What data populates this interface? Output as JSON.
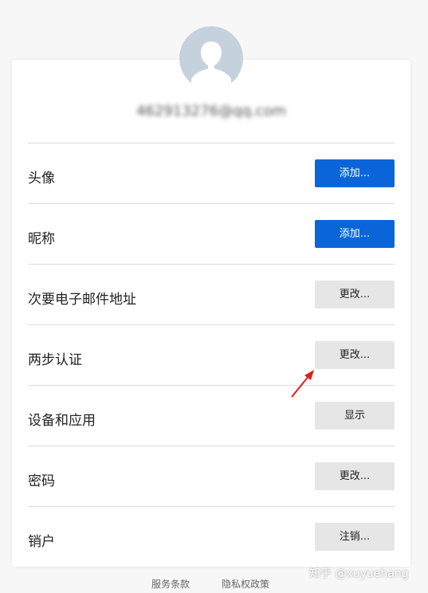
{
  "profile": {
    "email": "462913276@qq.com"
  },
  "rows": [
    {
      "label": "头像",
      "button": "添加...",
      "style": "primary"
    },
    {
      "label": "昵称",
      "button": "添加...",
      "style": "primary"
    },
    {
      "label": "次要电子邮件地址",
      "button": "更改...",
      "style": "secondary"
    },
    {
      "label": "两步认证",
      "button": "更改...",
      "style": "secondary"
    },
    {
      "label": "设备和应用",
      "button": "显示",
      "style": "secondary"
    },
    {
      "label": "密码",
      "button": "更改...",
      "style": "secondary"
    },
    {
      "label": "销户",
      "button": "注销...",
      "style": "secondary"
    }
  ],
  "footer": {
    "terms": "服务条款",
    "privacy": "隐私权政策"
  },
  "watermark": "知乎 @xuyuehang",
  "colors": {
    "primary_button": "#0a66d8",
    "secondary_button": "#e6e6e6",
    "annotation_arrow": "#e0201c"
  },
  "icons": {
    "avatar": "user-silhouette-icon",
    "annotation": "red-arrow-icon"
  }
}
